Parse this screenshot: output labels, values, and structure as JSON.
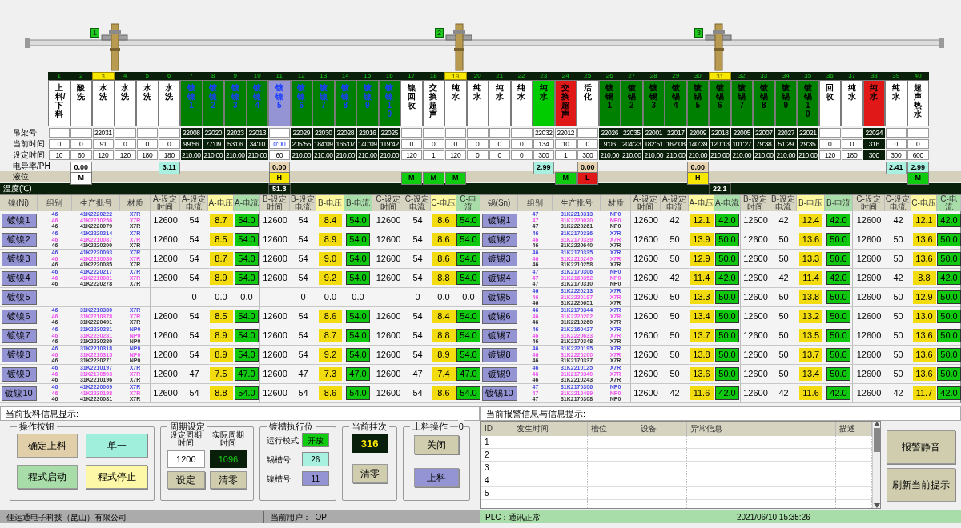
{
  "hoists": [
    {
      "label": "1"
    },
    {
      "label": "2"
    },
    {
      "label": "3"
    }
  ],
  "row_labels": [
    "吊架号",
    "当前时间",
    "设定时间",
    "电导率/PH",
    "液位",
    "温度(℃)"
  ],
  "tanks": [
    {
      "no": "1",
      "highlighted": false,
      "name": "上料/下料",
      "color": "#ffffff",
      "kind": "standard",
      "active": false,
      "current_time": "0",
      "set_time": "10"
    },
    {
      "no": "2",
      "highlighted": false,
      "name": "酸洗",
      "color": "#ffffff",
      "kind": "standard",
      "active": false,
      "current_time": "0",
      "set_time": "60",
      "conductivity": {
        "value": "0.00",
        "color": "#ffffff"
      },
      "level": {
        "value": "M",
        "color": "#ffffff"
      }
    },
    {
      "no": "3",
      "highlighted": true,
      "name": "水洗",
      "color": "#ffffff",
      "kind": "standard",
      "active": false,
      "rack": "22031",
      "current_time": "91",
      "set_time": "120"
    },
    {
      "no": "4",
      "highlighted": false,
      "name": "水洗",
      "color": "#ffffff",
      "kind": "standard",
      "active": false,
      "current_time": "0",
      "set_time": "120"
    },
    {
      "no": "5",
      "highlighted": false,
      "name": "水洗",
      "color": "#ffffff",
      "kind": "standard",
      "active": false,
      "current_time": "0",
      "set_time": "180"
    },
    {
      "no": "6",
      "highlighted": false,
      "name": "水洗",
      "color": "#ffffff",
      "kind": "standard",
      "active": false,
      "current_time": "0",
      "set_time": "180",
      "conductivity": {
        "value": "3.11",
        "color": "#a8f0e0"
      }
    },
    {
      "no": "7",
      "highlighted": false,
      "name": "镀镍1",
      "color": "#008000",
      "kind": "nickel",
      "active": true,
      "rack": "22008",
      "current_time": "99:56",
      "set_time": "210:00"
    },
    {
      "no": "8",
      "highlighted": false,
      "name": "镀镍2",
      "color": "#008000",
      "kind": "nickel",
      "active": true,
      "rack": "22020",
      "current_time": "77:09",
      "set_time": "210:00"
    },
    {
      "no": "9",
      "highlighted": false,
      "name": "镀镍3",
      "color": "#008000",
      "kind": "nickel",
      "active": true,
      "rack": "22023",
      "current_time": "53:06",
      "set_time": "210:00"
    },
    {
      "no": "10",
      "highlighted": false,
      "name": "镀镍4",
      "color": "#008000",
      "kind": "nickel",
      "active": true,
      "rack": "22013",
      "current_time": "34:10",
      "set_time": "210:00"
    },
    {
      "no": "11",
      "highlighted": false,
      "name": "镀镍5",
      "color": "#9494d4",
      "kind": "nickel",
      "active": false,
      "current_time": "0:00",
      "set_time": "60",
      "conductivity": {
        "value": "0.00",
        "color": "#e8d4b0"
      },
      "level": {
        "value": "H",
        "color": "#f8e800"
      },
      "temperature": "51.3"
    },
    {
      "no": "12",
      "highlighted": false,
      "name": "镀镍6",
      "color": "#008000",
      "kind": "nickel",
      "active": true,
      "rack": "22029",
      "current_time": "205:55",
      "set_time": "210:00"
    },
    {
      "no": "13",
      "highlighted": false,
      "name": "镀镍7",
      "color": "#008000",
      "kind": "nickel",
      "active": true,
      "rack": "22030",
      "current_time": "184:09",
      "set_time": "210:00"
    },
    {
      "no": "14",
      "highlighted": false,
      "name": "镀镍8",
      "color": "#008000",
      "kind": "nickel",
      "active": true,
      "rack": "22028",
      "current_time": "165:07",
      "set_time": "210:00"
    },
    {
      "no": "15",
      "highlighted": false,
      "name": "镀镍9",
      "color": "#008000",
      "kind": "nickel",
      "active": true,
      "rack": "22016",
      "current_time": "140:09",
      "set_time": "210:00"
    },
    {
      "no": "16",
      "highlighted": false,
      "name": "镀镍10",
      "color": "#008000",
      "kind": "nickel",
      "active": true,
      "rack": "22025",
      "current_time": "119:42",
      "set_time": "210:00"
    },
    {
      "no": "17",
      "highlighted": false,
      "name": "镍回收",
      "color": "#ffffff",
      "kind": "standard",
      "active": false,
      "current_time": "0",
      "set_time": "120",
      "level": {
        "value": "M",
        "color": "#10cc10"
      }
    },
    {
      "no": "18",
      "highlighted": false,
      "name": "交换超声",
      "color": "#ffffff",
      "kind": "standard",
      "active": false,
      "current_time": "0",
      "set_time": "1",
      "level": {
        "value": "M",
        "color": "#10cc10"
      }
    },
    {
      "no": "19",
      "highlighted": true,
      "name": "纯水",
      "color": "#ffffff",
      "kind": "standard",
      "active": false,
      "current_time": "0",
      "set_time": "120",
      "level": {
        "value": "M",
        "color": "#10cc10"
      }
    },
    {
      "no": "20",
      "highlighted": false,
      "name": "纯水",
      "color": "#ffffff",
      "kind": "standard",
      "active": false,
      "current_time": "0",
      "set_time": "0"
    },
    {
      "no": "21",
      "highlighted": false,
      "name": "纯水",
      "color": "#ffffff",
      "kind": "standard",
      "active": false,
      "current_time": "0",
      "set_time": "0"
    },
    {
      "no": "22",
      "highlighted": false,
      "name": "纯水",
      "color": "#ffffff",
      "kind": "standard",
      "active": false,
      "current_time": "0",
      "set_time": "0"
    },
    {
      "no": "23",
      "highlighted": false,
      "name": "纯水",
      "color": "#00cc00",
      "kind": "standard",
      "active": false,
      "rack": "22032",
      "current_time": "134",
      "set_time": "300",
      "conductivity": {
        "value": "2.99",
        "color": "#a8f0e0"
      }
    },
    {
      "no": "24",
      "highlighted": false,
      "name": "交换超声",
      "color": "#e01818",
      "kind": "standard",
      "active": false,
      "rack": "22012",
      "current_time": "10",
      "set_time": "1",
      "level": {
        "value": "M",
        "color": "#10cc10"
      }
    },
    {
      "no": "25",
      "highlighted": false,
      "name": "活化",
      "color": "#ffffff",
      "kind": "standard",
      "active": false,
      "current_time": "0",
      "set_time": "300",
      "conductivity": {
        "value": "0.00",
        "color": "#e8d4b0"
      },
      "level": {
        "value": "L",
        "color": "#e01818"
      }
    },
    {
      "no": "26",
      "highlighted": false,
      "name": "镀锡1",
      "color": "#008000",
      "kind": "standard",
      "active": true,
      "rack": "22026",
      "current_time": "9:06",
      "set_time": "210:00"
    },
    {
      "no": "27",
      "highlighted": false,
      "name": "镀锡2",
      "color": "#008000",
      "kind": "standard",
      "active": true,
      "rack": "22035",
      "current_time": "204:23",
      "set_time": "210:00"
    },
    {
      "no": "28",
      "highlighted": false,
      "name": "镀锡3",
      "color": "#008000",
      "kind": "standard",
      "active": true,
      "rack": "22001",
      "current_time": "182:51",
      "set_time": "210:00"
    },
    {
      "no": "29",
      "highlighted": false,
      "name": "镀锡4",
      "color": "#008000",
      "kind": "standard",
      "active": true,
      "rack": "22017",
      "current_time": "162:08",
      "set_time": "210:00"
    },
    {
      "no": "30",
      "highlighted": false,
      "name": "镀锡5",
      "color": "#008000",
      "kind": "standard",
      "active": true,
      "rack": "22009",
      "current_time": "140:39",
      "set_time": "210:00",
      "conductivity": {
        "value": "0.00",
        "color": "#e8d4b0"
      },
      "level": {
        "value": "H",
        "color": "#f8e800"
      }
    },
    {
      "no": "31",
      "highlighted": true,
      "name": "镀锡6",
      "color": "#008000",
      "kind": "standard",
      "active": true,
      "rack": "22018",
      "current_time": "120:13",
      "set_time": "210:00",
      "temperature": "22.1"
    },
    {
      "no": "32",
      "highlighted": false,
      "name": "镀锡7",
      "color": "#008000",
      "kind": "standard",
      "active": true,
      "rack": "22005",
      "current_time": "101:27",
      "set_time": "210:00"
    },
    {
      "no": "33",
      "highlighted": false,
      "name": "镀锡8",
      "color": "#008000",
      "kind": "standard",
      "active": true,
      "rack": "22007",
      "current_time": "79:38",
      "set_time": "210:00"
    },
    {
      "no": "34",
      "highlighted": false,
      "name": "镀锡9",
      "color": "#008000",
      "kind": "standard",
      "active": true,
      "rack": "22027",
      "current_time": "51:29",
      "set_time": "210:00"
    },
    {
      "no": "35",
      "highlighted": false,
      "name": "镀锡10",
      "color": "#008000",
      "kind": "standard",
      "active": true,
      "rack": "22021",
      "current_time": "29:35",
      "set_time": "210:00"
    },
    {
      "no": "36",
      "highlighted": false,
      "name": "回收",
      "color": "#ffffff",
      "kind": "standard",
      "active": false,
      "current_time": "0",
      "set_time": "120"
    },
    {
      "no": "37",
      "highlighted": false,
      "name": "纯水",
      "color": "#ffffff",
      "kind": "standard",
      "active": false,
      "current_time": "0",
      "set_time": "180"
    },
    {
      "no": "38",
      "highlighted": false,
      "name": "纯水",
      "color": "#e01818",
      "kind": "standard",
      "active": true,
      "rack": "22024",
      "current_time": "316",
      "set_time": "300"
    },
    {
      "no": "39",
      "highlighted": false,
      "name": "纯水",
      "color": "#ffffff",
      "kind": "standard",
      "active": false,
      "current_time": "0",
      "set_time": "300",
      "conductivity": {
        "value": "2.41",
        "color": "#a8f0e0"
      }
    },
    {
      "no": "40",
      "highlighted": false,
      "name": "超声热水",
      "color": "#ffffff",
      "kind": "standard",
      "active": false,
      "current_time": "0",
      "set_time": "600",
      "conductivity": {
        "value": "2.99",
        "color": "#a8f0e0"
      },
      "level": {
        "value": "M",
        "color": "#10cc10"
      }
    }
  ],
  "nickel_table": {
    "columns": [
      {
        "label": "镍(Ni)",
        "kind": "text"
      },
      {
        "label": "组别",
        "kind": "text"
      },
      {
        "label": "生产批号",
        "kind": "text"
      },
      {
        "label": "材质",
        "kind": "text"
      },
      {
        "label": "A-设定时间",
        "kind": "text"
      },
      {
        "label": "A-设定电流",
        "kind": "text"
      },
      {
        "label": "A-电压",
        "kind": "voltage"
      },
      {
        "label": "A-电流",
        "kind": "current"
      },
      {
        "label": "B-设定时间",
        "kind": "text"
      },
      {
        "label": "B-设定电流",
        "kind": "text"
      },
      {
        "label": "B-电压",
        "kind": "voltage"
      },
      {
        "label": "B-电流",
        "kind": "current"
      },
      {
        "label": "C-设定时间",
        "kind": "text"
      },
      {
        "label": "C-设定电流",
        "kind": "text"
      },
      {
        "label": "C-电压",
        "kind": "voltage"
      },
      {
        "label": "C-电流",
        "kind": "current"
      }
    ],
    "rows": [
      {
        "tank": "镀镍1",
        "active": true,
        "groups": [
          "46",
          "46",
          "46"
        ],
        "batches": [
          "41K2220222",
          "41K2210256",
          "41K2220079"
        ],
        "materials": [
          "X7R",
          "X7R",
          "X7R"
        ],
        "phases": [
          {
            "set_time": "12600",
            "set_current": "54",
            "voltage": "8.7",
            "current": "54.0"
          },
          {
            "set_time": "12600",
            "set_current": "54",
            "voltage": "8.4",
            "current": "54.0"
          },
          {
            "set_time": "12600",
            "set_current": "54",
            "voltage": "8.6",
            "current": "54.0"
          }
        ]
      },
      {
        "tank": "镀镍2",
        "active": true,
        "groups": [
          "46",
          "46",
          "46"
        ],
        "batches": [
          "41K2220214",
          "41K2210087",
          "41K2220200"
        ],
        "materials": [
          "X7R",
          "X7R",
          "X7R"
        ],
        "phases": [
          {
            "set_time": "12600",
            "set_current": "54",
            "voltage": "8.5",
            "current": "54.0"
          },
          {
            "set_time": "12600",
            "set_current": "54",
            "voltage": "8.9",
            "current": "54.0"
          },
          {
            "set_time": "12600",
            "set_current": "54",
            "voltage": "8.6",
            "current": "54.0"
          }
        ]
      },
      {
        "tank": "镀镍3",
        "active": true,
        "groups": [
          "46",
          "46",
          "46"
        ],
        "batches": [
          "41K2220093",
          "41K2210080",
          "41K2220085"
        ],
        "materials": [
          "X7R",
          "X7R",
          "X7R"
        ],
        "phases": [
          {
            "set_time": "12600",
            "set_current": "54",
            "voltage": "8.7",
            "current": "54.0"
          },
          {
            "set_time": "12600",
            "set_current": "54",
            "voltage": "9.0",
            "current": "54.0"
          },
          {
            "set_time": "12600",
            "set_current": "54",
            "voltage": "8.6",
            "current": "54.0"
          }
        ]
      },
      {
        "tank": "镀镍4",
        "active": true,
        "groups": [
          "46",
          "46",
          "46"
        ],
        "batches": [
          "41K2220217",
          "41K2210081",
          "41K2220278"
        ],
        "materials": [
          "X7R",
          "X7R",
          "X7R"
        ],
        "phases": [
          {
            "set_time": "12600",
            "set_current": "54",
            "voltage": "8.9",
            "current": "54.0"
          },
          {
            "set_time": "12600",
            "set_current": "54",
            "voltage": "9.2",
            "current": "54.0"
          },
          {
            "set_time": "12600",
            "set_current": "54",
            "voltage": "8.8",
            "current": "54.0"
          }
        ]
      },
      {
        "tank": "镀镍5",
        "active": false,
        "phases": [
          {
            "set_current": "0",
            "voltage": "0.0",
            "current": "0.0"
          },
          {
            "set_current": "0",
            "voltage": "0.0",
            "current": "0.0"
          },
          {
            "set_current": "0",
            "voltage": "0.0",
            "current": "0.0"
          }
        ]
      },
      {
        "tank": "镀镍6",
        "active": true,
        "groups": [
          "46",
          "46",
          "46"
        ],
        "batches": [
          "31K2210380",
          "31K2210378",
          "31K2220491"
        ],
        "materials": [
          "X7R",
          "X7R",
          "X7R"
        ],
        "phases": [
          {
            "set_time": "12600",
            "set_current": "54",
            "voltage": "8.5",
            "current": "54.0"
          },
          {
            "set_time": "12600",
            "set_current": "54",
            "voltage": "8.6",
            "current": "54.0"
          },
          {
            "set_time": "12600",
            "set_current": "54",
            "voltage": "8.4",
            "current": "54.0"
          }
        ]
      },
      {
        "tank": "镀镍7",
        "active": true,
        "groups": [
          "46",
          "46",
          "46"
        ],
        "batches": [
          "31K2230281",
          "31K2230281",
          "31K2230280"
        ],
        "materials": [
          "NP0",
          "NP0",
          "NP0"
        ],
        "phases": [
          {
            "set_time": "12600",
            "set_current": "54",
            "voltage": "8.9",
            "current": "54.0"
          },
          {
            "set_time": "12600",
            "set_current": "54",
            "voltage": "8.7",
            "current": "54.0"
          },
          {
            "set_time": "12600",
            "set_current": "54",
            "voltage": "8.8",
            "current": "54.0"
          }
        ]
      },
      {
        "tank": "镀镍8",
        "active": true,
        "groups": [
          "46",
          "46",
          "46"
        ],
        "batches": [
          "31K2210318",
          "31K2210315",
          "31K2230271"
        ],
        "materials": [
          "NP0",
          "NP0",
          "NP0"
        ],
        "phases": [
          {
            "set_time": "12600",
            "set_current": "54",
            "voltage": "8.9",
            "current": "54.0"
          },
          {
            "set_time": "12600",
            "set_current": "54",
            "voltage": "9.2",
            "current": "54.0"
          },
          {
            "set_time": "12600",
            "set_current": "54",
            "voltage": "8.9",
            "current": "54.0"
          }
        ]
      },
      {
        "tank": "镀镍9",
        "active": true,
        "groups": [
          "46",
          "46",
          "46"
        ],
        "batches": [
          "31K2210197",
          "31K2170503",
          "31K2210196"
        ],
        "materials": [
          "X7R",
          "X7R",
          "X7R"
        ],
        "phases": [
          {
            "set_time": "12600",
            "set_current": "47",
            "voltage": "7.5",
            "current": "47.0"
          },
          {
            "set_time": "12600",
            "set_current": "47",
            "voltage": "7.3",
            "current": "47.0"
          },
          {
            "set_time": "12600",
            "set_current": "47",
            "voltage": "7.4",
            "current": "47.0"
          }
        ]
      },
      {
        "tank": "镀镍10",
        "active": true,
        "groups": [
          "46",
          "46",
          "46"
        ],
        "batches": [
          "41K2220069",
          "41K2230198",
          "41K2230081"
        ],
        "materials": [
          "X7R",
          "X7R",
          "X7R"
        ],
        "phases": [
          {
            "set_time": "12600",
            "set_current": "54",
            "voltage": "8.8",
            "current": "54.0"
          },
          {
            "set_time": "12600",
            "set_current": "54",
            "voltage": "8.6",
            "current": "54.0"
          },
          {
            "set_time": "12600",
            "set_current": "54",
            "voltage": "8.6",
            "current": "54.0"
          }
        ]
      }
    ]
  },
  "tin_table": {
    "columns": [
      {
        "label": "锡(Sn)",
        "kind": "text"
      },
      {
        "label": "组别",
        "kind": "text"
      },
      {
        "label": "生产批号",
        "kind": "text"
      },
      {
        "label": "材质",
        "kind": "text"
      },
      {
        "label": "A-设定时间",
        "kind": "text"
      },
      {
        "label": "A-设定电流",
        "kind": "text"
      },
      {
        "label": "A-电压",
        "kind": "voltage"
      },
      {
        "label": "A-电流",
        "kind": "current"
      },
      {
        "label": "B-设定时间",
        "kind": "text"
      },
      {
        "label": "B-设定电流",
        "kind": "text"
      },
      {
        "label": "B-电压",
        "kind": "voltage"
      },
      {
        "label": "B-电流",
        "kind": "current"
      },
      {
        "label": "C-设定时间",
        "kind": "text"
      },
      {
        "label": "C-设定电流",
        "kind": "text"
      },
      {
        "label": "C-电压",
        "kind": "voltage"
      },
      {
        "label": "C-电流",
        "kind": "current"
      }
    ],
    "rows": [
      {
        "tank": "镀锡1",
        "active": true,
        "groups": [
          "47",
          "47",
          "47"
        ],
        "batches": [
          "31K2210313",
          "31K2220020",
          "31K2220261"
        ],
        "materials": [
          "NP0",
          "NP0",
          "NP0"
        ],
        "phases": [
          {
            "set_time": "12600",
            "set_current": "42",
            "voltage": "12.1",
            "current": "42.0"
          },
          {
            "set_time": "12600",
            "set_current": "42",
            "voltage": "12.4",
            "current": "42.0"
          },
          {
            "set_time": "12600",
            "set_current": "42",
            "voltage": "12.1",
            "current": "42.0"
          }
        ]
      },
      {
        "tank": "镀锡2",
        "active": true,
        "groups": [
          "46",
          "46",
          "46"
        ],
        "batches": [
          "31K2170336",
          "31K2170339",
          "31K2220640"
        ],
        "materials": [
          "X7R",
          "X7R",
          "X7R"
        ],
        "phases": [
          {
            "set_time": "12600",
            "set_current": "50",
            "voltage": "13.9",
            "current": "50.0"
          },
          {
            "set_time": "12600",
            "set_current": "50",
            "voltage": "13.6",
            "current": "50.0"
          },
          {
            "set_time": "12600",
            "set_current": "50",
            "voltage": "13.6",
            "current": "50.0"
          }
        ]
      },
      {
        "tank": "镀锡3",
        "active": true,
        "groups": [
          "46",
          "46",
          "46"
        ],
        "batches": [
          "31K2170335",
          "31K2210249",
          "31K2210258"
        ],
        "materials": [
          "X7R",
          "X7R",
          "X7R"
        ],
        "phases": [
          {
            "set_time": "12600",
            "set_current": "50",
            "voltage": "12.9",
            "current": "50.0"
          },
          {
            "set_time": "12600",
            "set_current": "50",
            "voltage": "13.3",
            "current": "50.0"
          },
          {
            "set_time": "12600",
            "set_current": "50",
            "voltage": "13.6",
            "current": "50.0"
          }
        ]
      },
      {
        "tank": "镀锡4",
        "active": true,
        "groups": [
          "47",
          "47",
          "47"
        ],
        "batches": [
          "31K2170306",
          "31K2160352",
          "31K2170310"
        ],
        "materials": [
          "NP0",
          "NP0",
          "NP0"
        ],
        "phases": [
          {
            "set_time": "12600",
            "set_current": "42",
            "voltage": "11.4",
            "current": "42.0"
          },
          {
            "set_time": "12600",
            "set_current": "42",
            "voltage": "11.4",
            "current": "42.0"
          },
          {
            "set_time": "12600",
            "set_current": "42",
            "voltage": "8.8",
            "current": "42.0"
          }
        ]
      },
      {
        "tank": "镀锡5",
        "active": true,
        "groups": [
          "46",
          "46",
          "46"
        ],
        "batches": [
          "31K2220213",
          "31K2220197",
          "31K2220651"
        ],
        "materials": [
          "X7R",
          "X7R",
          "X7R"
        ],
        "phases": [
          {
            "set_time": "12600",
            "set_current": "50",
            "voltage": "13.3",
            "current": "50.0"
          },
          {
            "set_time": "12600",
            "set_current": "50",
            "voltage": "13.8",
            "current": "50.0"
          },
          {
            "set_time": "12600",
            "set_current": "50",
            "voltage": "12.9",
            "current": "50.0"
          }
        ]
      },
      {
        "tank": "镀锡6",
        "active": true,
        "groups": [
          "46",
          "46",
          "46"
        ],
        "batches": [
          "31K2170344",
          "31K2220202",
          "31K2210260"
        ],
        "materials": [
          "X7R",
          "X7R",
          "X7R"
        ],
        "phases": [
          {
            "set_time": "12600",
            "set_current": "50",
            "voltage": "13.4",
            "current": "50.0"
          },
          {
            "set_time": "12600",
            "set_current": "50",
            "voltage": "13.2",
            "current": "50.0"
          },
          {
            "set_time": "12600",
            "set_current": "50",
            "voltage": "13.0",
            "current": "50.0"
          }
        ]
      },
      {
        "tank": "镀锡7",
        "active": true,
        "groups": [
          "46",
          "46",
          "46"
        ],
        "batches": [
          "31K2160427",
          "31K2220633",
          "31K2170348"
        ],
        "materials": [
          "X7R",
          "X7R",
          "X7R"
        ],
        "phases": [
          {
            "set_time": "12600",
            "set_current": "50",
            "voltage": "13.7",
            "current": "50.0"
          },
          {
            "set_time": "12600",
            "set_current": "50",
            "voltage": "13.5",
            "current": "50.0"
          },
          {
            "set_time": "12600",
            "set_current": "50",
            "voltage": "13.6",
            "current": "50.0"
          }
        ]
      },
      {
        "tank": "镀锡8",
        "active": true,
        "groups": [
          "46",
          "46",
          "46"
        ],
        "batches": [
          "31K2220195",
          "31K2220200",
          "31K2170337"
        ],
        "materials": [
          "X7R",
          "X7R",
          "X7R"
        ],
        "phases": [
          {
            "set_time": "12600",
            "set_current": "50",
            "voltage": "13.8",
            "current": "50.0"
          },
          {
            "set_time": "12600",
            "set_current": "50",
            "voltage": "13.7",
            "current": "50.0"
          },
          {
            "set_time": "12600",
            "set_current": "50",
            "voltage": "13.6",
            "current": "50.0"
          }
        ]
      },
      {
        "tank": "镀锡9",
        "active": true,
        "groups": [
          "46",
          "46",
          "46"
        ],
        "batches": [
          "31K2210125",
          "31K2170340",
          "31K2210243"
        ],
        "materials": [
          "X7R",
          "X7R",
          "X7R"
        ],
        "phases": [
          {
            "set_time": "12600",
            "set_current": "50",
            "voltage": "13.6",
            "current": "50.0"
          },
          {
            "set_time": "12600",
            "set_current": "50",
            "voltage": "13.4",
            "current": "50.0"
          },
          {
            "set_time": "12600",
            "set_current": "50",
            "voltage": "13.6",
            "current": "50.0"
          }
        ]
      },
      {
        "tank": "镀锡10",
        "active": true,
        "groups": [
          "47",
          "47",
          "47"
        ],
        "batches": [
          "31K2170306",
          "31K2210499",
          "31K2170308"
        ],
        "materials": [
          "NP0",
          "NP0",
          "NP0"
        ],
        "phases": [
          {
            "set_time": "12600",
            "set_current": "42",
            "voltage": "11.6",
            "current": "42.0"
          },
          {
            "set_time": "12600",
            "set_current": "42",
            "voltage": "11.6",
            "current": "42.0"
          },
          {
            "set_time": "12600",
            "set_current": "42",
            "voltage": "11.7",
            "current": "42.0"
          }
        ]
      }
    ]
  },
  "feed_panel": {
    "title": "当前投料信息显示:",
    "operation": {
      "title": "操作按钮",
      "buttons": [
        {
          "label": "确定上料",
          "color": "#e0cfa8"
        },
        {
          "label": "单一",
          "color": "#a0eedc"
        },
        {
          "label": "程式启动",
          "color": "#a8dca8"
        },
        {
          "label": "程式停止",
          "color": "#fdf8a8"
        }
      ]
    },
    "cycle": {
      "title": "周期设定",
      "set_label": "设定周期时间",
      "actual_label": "实际周期时间",
      "set_value": "1200",
      "actual_value": "1096",
      "buttons": [
        "设定",
        "清零"
      ]
    },
    "position": {
      "title": "镀槽执行位",
      "rows": [
        {
          "label": "运行模式",
          "value": "开放",
          "color": "#10cc10"
        },
        {
          "label": "锡槽号",
          "value": "26",
          "color": "#a8f0e0"
        },
        {
          "label": "镍槽号",
          "value": "11",
          "color": "#9494d4"
        }
      ]
    },
    "count": {
      "title": "当前挂次",
      "value": "316",
      "button": "清零"
    },
    "loading": {
      "title": "上料操作",
      "counter": "0",
      "buttons": [
        {
          "label": "关闭",
          "color": "#cfcdae"
        },
        {
          "label": "上料",
          "color": "#9494d4"
        }
      ]
    }
  },
  "alarm_panel": {
    "title": "当前报警信息与信息提示:",
    "columns": [
      "ID",
      "发生时间",
      "槽位",
      "设备",
      "异常信息",
      "描述"
    ],
    "rows": [
      {
        "id": "1"
      },
      {
        "id": "2"
      },
      {
        "id": "3"
      },
      {
        "id": "4"
      },
      {
        "id": "5"
      }
    ],
    "buttons": [
      "报警静音",
      "刷新当前提示"
    ]
  },
  "status_bar": {
    "company": "佳运通电子科技（昆山）有限公司",
    "user": "当前用户：  OP",
    "plc": "PLC：通讯正常",
    "datetime": "2021/06/10 15:35:26"
  }
}
